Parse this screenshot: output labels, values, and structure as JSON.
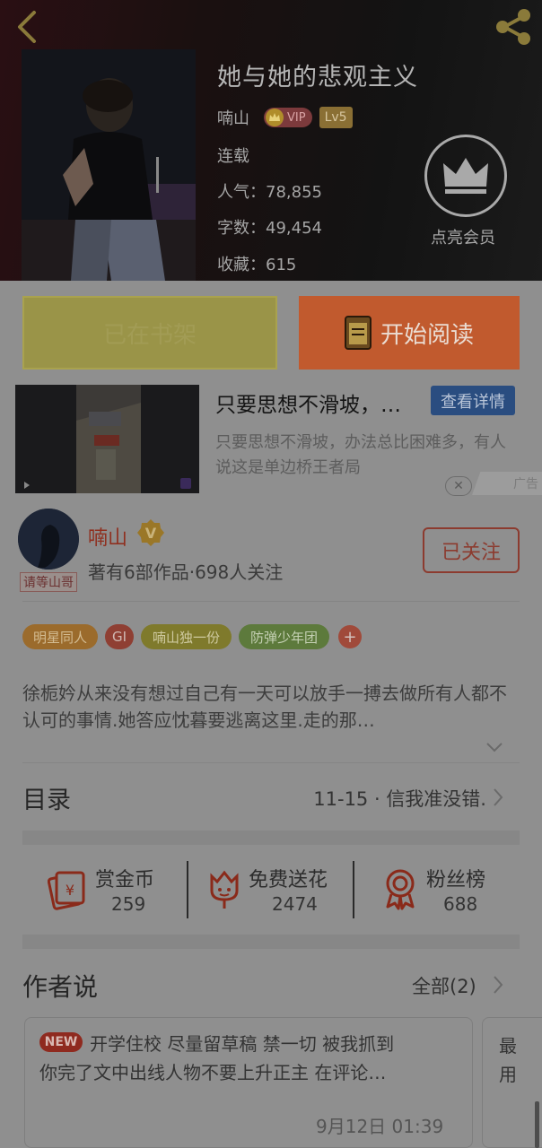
{
  "book": {
    "title": "她与她的悲观主义",
    "author": "喃山",
    "vip_label": "VIP",
    "level": "Lv5",
    "status": "连载",
    "popularity": "人气：78,855",
    "word_count": "字数：49,454",
    "favorites": "收藏：615",
    "vip_member_label": "点亮会员"
  },
  "actions": {
    "shelf_label": "已在书架",
    "read_label": "开始阅读"
  },
  "ad": {
    "title": "只要思想不滑坡，…",
    "detail_label": "查看详情",
    "description": "只要思想不滑坡，办法总比困难多，有人说这是单边桥王者局",
    "close_symbol": "✕",
    "tag_label": "广告"
  },
  "author_card": {
    "name": "喃山",
    "avatar_tag": "请等山哥",
    "stats": "著有6部作品·698人关注",
    "follow_label": "已关注"
  },
  "tags": [
    {
      "label": "明星同人",
      "bg": "#9b6b2c",
      "fg": "#d3bc92"
    },
    {
      "label": "GI",
      "bg": "#8f3f33",
      "fg": "#d0b8b2"
    },
    {
      "label": "喃山独一份",
      "bg": "#7f7a2c",
      "fg": "#cfcaa0"
    },
    {
      "label": "防弹少年团",
      "bg": "#5d7a3c",
      "fg": "#c4d0b3"
    }
  ],
  "tag_plus": "+",
  "synopsis": "徐栀妗从来没有想过自己有一天可以放手一搏去做所有人都不认可的事情.她答应忱暮要逃离这里.走的那…",
  "catalog": {
    "label": "目录",
    "latest": "11-15 · 信我准没错."
  },
  "stats": [
    {
      "label": "赏金币",
      "value": "259"
    },
    {
      "label": "免费送花",
      "value": "2474"
    },
    {
      "label": "粉丝榜",
      "value": "688"
    }
  ],
  "author_says": {
    "label": "作者说",
    "all_label": "全部(2)",
    "card": {
      "new_label": "NEW",
      "line1": "开学住校 尽量留草稿 禁一切 被我抓到",
      "line2": "你完了文中出线人物不要上升正主 在评论…",
      "time": "9月12日  01:39"
    },
    "card2": {
      "line1": "最",
      "line2": "用"
    }
  },
  "colors": {
    "overlay_bg": "#8f8f8f",
    "accent_orange": "#c15a2e",
    "shelf_yellow": "#9a9448",
    "link_blue": "#2a4d80"
  }
}
